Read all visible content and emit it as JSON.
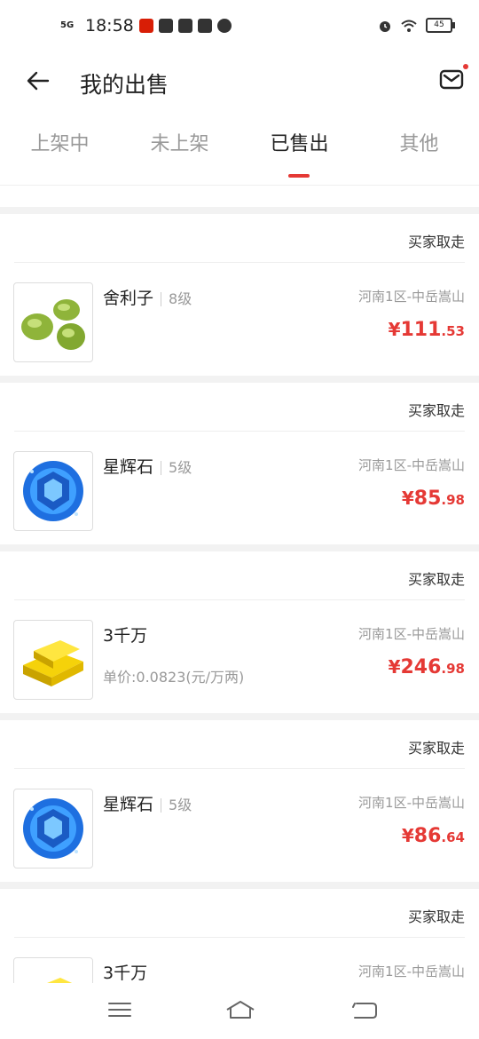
{
  "status_bar": {
    "network": "5G",
    "time": "18:58",
    "battery": "45"
  },
  "header": {
    "title": "我的出售"
  },
  "tabs": [
    {
      "label": "上架中"
    },
    {
      "label": "未上架"
    },
    {
      "label": "已售出"
    },
    {
      "label": "其他"
    }
  ],
  "active_tab": "已售出",
  "orders": [
    {
      "status": "买家取走",
      "name": "舍利子",
      "level": "8级",
      "server": "河南1区-中岳嵩山",
      "price_symbol": "¥",
      "price_int": "111",
      "price_dec": ".53",
      "thumb_icon": "sarira-icon"
    },
    {
      "status": "买家取走",
      "name": "星辉石",
      "level": "5级",
      "server": "河南1区-中岳嵩山",
      "price_symbol": "¥",
      "price_int": "85",
      "price_dec": ".98",
      "thumb_icon": "blue-gem-icon"
    },
    {
      "status": "买家取走",
      "name": "3千万",
      "unit_price": "单价:0.0823(元/万两)",
      "server": "河南1区-中岳嵩山",
      "price_symbol": "¥",
      "price_int": "246",
      "price_dec": ".98",
      "thumb_icon": "gold-bars-icon"
    },
    {
      "status": "买家取走",
      "name": "星辉石",
      "level": "5级",
      "server": "河南1区-中岳嵩山",
      "price_symbol": "¥",
      "price_int": "86",
      "price_dec": ".64",
      "thumb_icon": "blue-gem-icon"
    },
    {
      "status": "买家取走",
      "name": "3千万",
      "server": "河南1区-中岳嵩山",
      "thumb_icon": "gold-bars-icon"
    }
  ],
  "colors": {
    "accent": "#e53935",
    "muted_text": "#999999"
  }
}
